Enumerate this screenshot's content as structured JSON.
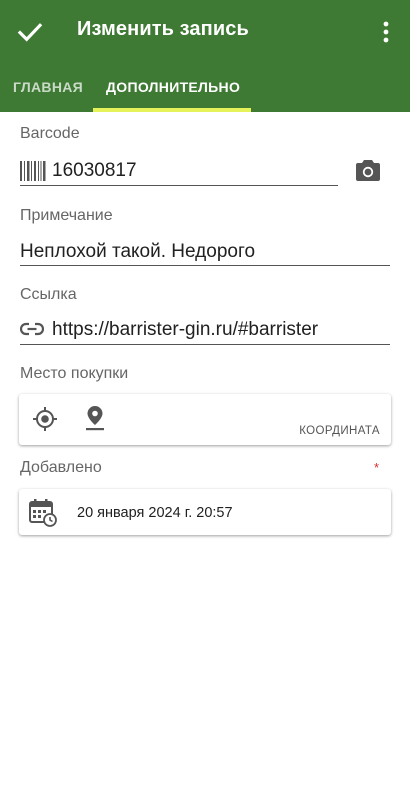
{
  "toolbar": {
    "title": "Изменить запись",
    "confirm_icon": "check-icon",
    "overflow_icon": "more-vert-icon"
  },
  "tabs": [
    {
      "label": "Главная",
      "active": false
    },
    {
      "label": "Дополнительно",
      "active": true
    }
  ],
  "colors": {
    "appbar": "#3e7a33",
    "tab_indicator": "#e6f25a",
    "required": "#d32f2f"
  },
  "form": {
    "barcode": {
      "label": "Barcode",
      "value": "16030817",
      "leading_icon": "barcode-icon",
      "action_icon": "camera-icon"
    },
    "note": {
      "label": "Примечание",
      "value": "Неплохой такой. Недорого"
    },
    "link": {
      "label": "Ссылка",
      "value": "https://barrister-gin.ru/#barrister",
      "leading_icon": "link-icon"
    },
    "place": {
      "label": "Место покупки",
      "locate_icon": "gps-target-icon",
      "pin_icon": "location-pin-icon",
      "coordinate_label": "Координата"
    },
    "added": {
      "label": "Добавлено",
      "required_mark": "*",
      "icon": "calendar-clock-icon",
      "value": "20 января 2024 г. 20:57"
    }
  }
}
